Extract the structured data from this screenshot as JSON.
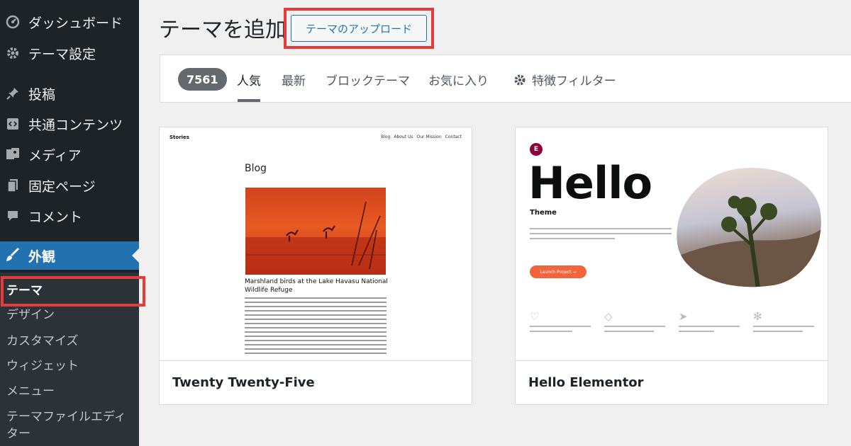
{
  "sidebar": {
    "items": [
      {
        "label": "ダッシュボード",
        "icon": "dashboard-icon"
      },
      {
        "label": "テーマ設定",
        "icon": "gear-icon"
      },
      {
        "label": "投稿",
        "icon": "pin-icon"
      },
      {
        "label": "共通コンテンツ",
        "icon": "code-block-icon"
      },
      {
        "label": "メディア",
        "icon": "media-icon"
      },
      {
        "label": "固定ページ",
        "icon": "page-icon"
      },
      {
        "label": "コメント",
        "icon": "comment-icon"
      },
      {
        "label": "外観",
        "icon": "brush-icon",
        "active": true
      }
    ],
    "submenu": [
      {
        "label": "テーマ",
        "current": true
      },
      {
        "label": "デザイン"
      },
      {
        "label": "カスタマイズ"
      },
      {
        "label": "ウィジェット"
      },
      {
        "label": "メニュー"
      },
      {
        "label": "テーマファイルエディター"
      }
    ]
  },
  "header": {
    "title": "テーマを追加",
    "upload_button": "テーマのアップロード"
  },
  "filter_bar": {
    "count": "7561",
    "tabs": [
      {
        "label": "人気",
        "current": true
      },
      {
        "label": "最新"
      },
      {
        "label": "ブロックテーマ"
      },
      {
        "label": "お気に入り"
      }
    ],
    "feature_filter": "特徴フィルター"
  },
  "themes": [
    {
      "name": "Twenty Twenty-Five",
      "preview": {
        "site_title": "Stories",
        "nav": [
          "Blog",
          "About Us",
          "Our Mission",
          "Contact"
        ],
        "heading": "Blog",
        "post_title": "Marshland birds at the Lake Havasu National Wildlife Refuge"
      }
    },
    {
      "name": "Hello Elementor",
      "preview": {
        "logo": "E",
        "headline": "Hello",
        "subheading": "Theme",
        "button": "Launch Project →"
      }
    }
  ],
  "colors": {
    "sidebar_bg": "#1d2327",
    "accent": "#2271b1",
    "highlight": "#e63b3b"
  }
}
